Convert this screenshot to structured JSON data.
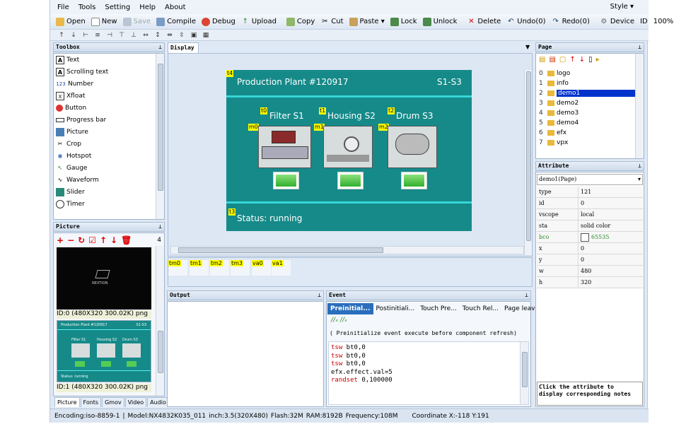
{
  "menu": {
    "file": "File",
    "tools": "Tools",
    "setting": "Setting",
    "help": "Help",
    "about": "About",
    "style": "Style ▾"
  },
  "toolbar": {
    "open": "Open",
    "new": "New",
    "save": "Save",
    "compile": "Compile",
    "debug": "Debug",
    "upload": "Upload",
    "copy": "Copy",
    "cut": "Cut",
    "paste": "Paste ▾",
    "lock": "Lock",
    "unlock": "Unlock",
    "delete": "Delete",
    "undo": "Undo(0)",
    "redo": "Redo(0)",
    "device": "Device",
    "id": "ID",
    "zoom": "100%"
  },
  "toolbox": {
    "title": "Toolbox",
    "items": [
      "Text",
      "Scrolling text",
      "Number",
      "Xfloat",
      "Button",
      "Progress bar",
      "Picture",
      "Crop",
      "Hotspot",
      "Gauge",
      "Waveform",
      "Slider",
      "Timer"
    ]
  },
  "picture": {
    "title": "Picture",
    "count": "4",
    "items": [
      {
        "label": "ID:0 (480X320 300.02K) png",
        "logo": "NEXTION"
      },
      {
        "label": "ID:1 (480X320 300.02K) png"
      }
    ],
    "mini": {
      "title": "Production Plant #120917",
      "code": "S1-S3",
      "labels": [
        "Filter S1",
        "Housing S2",
        "Drum S3"
      ],
      "status": "Status: running"
    }
  },
  "left_tabs": [
    "Picture",
    "Fonts",
    "Gmov",
    "Video",
    "Audio"
  ],
  "display": {
    "tab": "Display",
    "title": "Production Plant #120917",
    "code": "S1-S3",
    "labels": [
      "Filter S1",
      "Housing S2",
      "Drum S3"
    ],
    "status": "Status: running",
    "tags": {
      "t4": "t4",
      "t0": "t0",
      "t1": "t1",
      "t2": "t2",
      "m0": "m0",
      "m1": "m1",
      "m2": "m2",
      "t3": "t3"
    }
  },
  "components": [
    "tm0",
    "tm1",
    "tm2",
    "tm3",
    "va0",
    "va1"
  ],
  "output": {
    "title": "Output"
  },
  "event": {
    "title": "Event",
    "tabs": [
      "Preinitial...",
      "Postinitiali...",
      "Touch Pre...",
      "Touch Rel...",
      "Page leave..."
    ],
    "comment": "( Preinitialize event execute before component refresh)",
    "code": [
      {
        "kw": "tsw",
        "rest": " bt0,0"
      },
      {
        "kw": "tsw",
        "rest": " bt0,0"
      },
      {
        "kw": "tsw",
        "rest": " bt0,0"
      },
      {
        "kw": "",
        "rest": "efx.effect.val=5"
      },
      {
        "kw": "randset",
        "rest": " 0,100000"
      }
    ]
  },
  "page": {
    "title": "Page",
    "items": [
      {
        "idx": "0",
        "name": "logo"
      },
      {
        "idx": "1",
        "name": "info"
      },
      {
        "idx": "2",
        "name": "demo1"
      },
      {
        "idx": "3",
        "name": "demo2"
      },
      {
        "idx": "4",
        "name": "demo3"
      },
      {
        "idx": "5",
        "name": "demo4"
      },
      {
        "idx": "6",
        "name": "efx"
      },
      {
        "idx": "7",
        "name": "vpx"
      }
    ],
    "selected": "demo1"
  },
  "attribute": {
    "title": "Attribute",
    "selector": "demo1(Page)",
    "rows": [
      {
        "k": "type",
        "v": "121"
      },
      {
        "k": "id",
        "v": "0"
      },
      {
        "k": "vscope",
        "v": "local"
      },
      {
        "k": "sta",
        "v": "solid color"
      },
      {
        "k": "bco",
        "v": "65535"
      },
      {
        "k": "x",
        "v": "0"
      },
      {
        "k": "y",
        "v": "0"
      },
      {
        "k": "w",
        "v": "480"
      },
      {
        "k": "h",
        "v": "320"
      }
    ],
    "note": "Click the attribute to display corresponding notes"
  },
  "status": {
    "encoding": "Encoding:iso-8859-1",
    "model": "Model:NX4832K035_011",
    "inch": "inch:3.5(320X480)",
    "flash": "Flash:32M",
    "ram": "RAM:8192B",
    "freq": "Frequency:108M",
    "coord": "Coordinate X:-118  Y:191"
  },
  "colors": {
    "screen": "#158a89",
    "accent": "#0033cc",
    "tag": "#ffff00"
  }
}
